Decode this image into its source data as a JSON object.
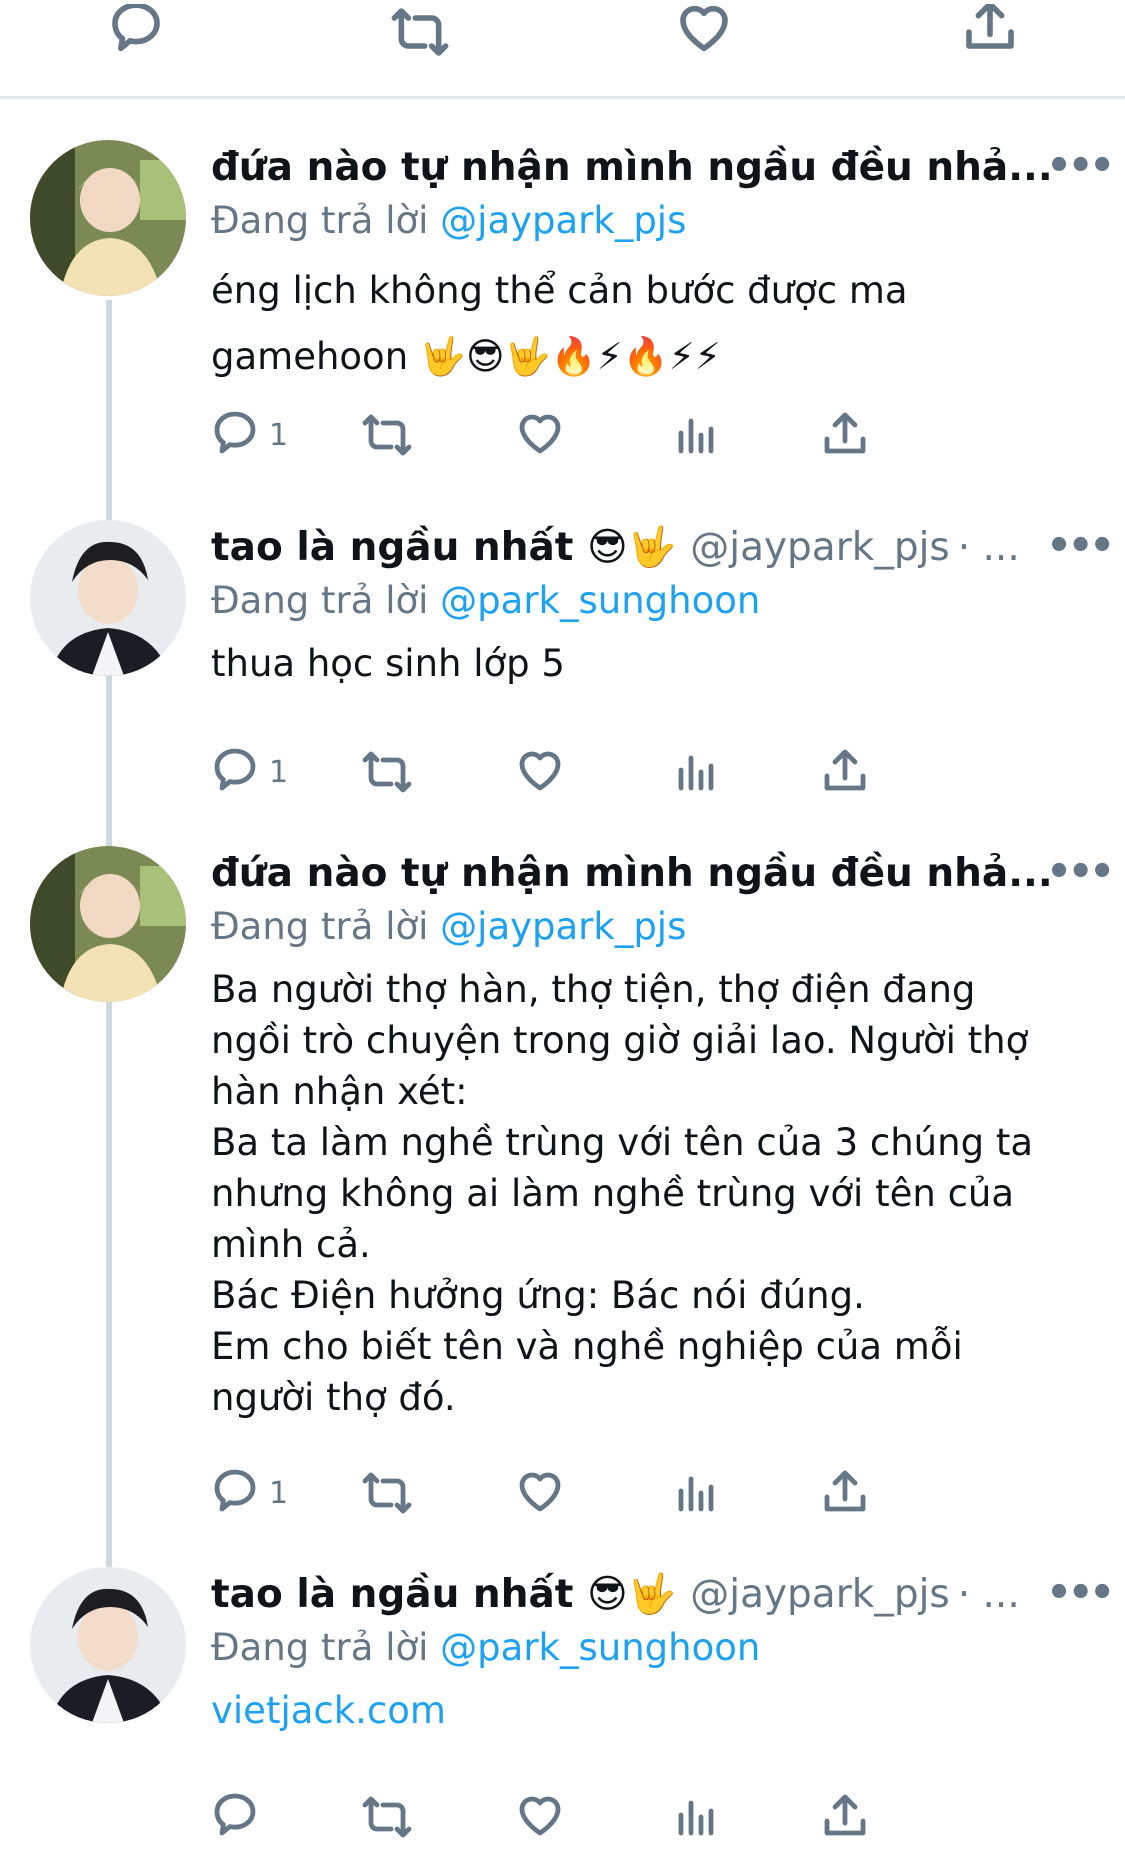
{
  "top_actions": [
    "reply-icon",
    "retweet-icon",
    "like-icon",
    "share-icon"
  ],
  "tweets": [
    {
      "name": "đứa nào tự nhận mình ngầu đều nhả...",
      "reply_prefix": "Đang trả lời",
      "reply_to": "@jaypark_pjs",
      "body": "éng lịch không thể cản bước được ma\ngamehoon 🤟😎🤟🔥⚡🔥⚡⚡",
      "reply_count": "1"
    },
    {
      "name": "tao là ngầu nhất 😎🤟",
      "handle": "@jaypark_pjs",
      "trail": "· ...",
      "reply_prefix": "Đang trả lời",
      "reply_to": "@park_sunghoon",
      "body": "thua học sinh lớp 5",
      "reply_count": "1"
    },
    {
      "name": "đứa nào tự nhận mình ngầu đều nhả...",
      "reply_prefix": "Đang trả lời",
      "reply_to": "@jaypark_pjs",
      "body": "Ba người thợ hàn, thợ tiện, thợ điện đang\nngồi trò chuyện trong giờ giải lao. Người thợ\nhàn nhận xét:\nBa ta làm nghề trùng với tên của 3 chúng ta\nnhưng không ai làm nghề trùng với tên của\nmình cả.\nBác Điện hưởng ứng: Bác nói đúng.\nEm cho biết tên và nghề nghiệp của mỗi\nngười thợ đó.",
      "reply_count": "1"
    },
    {
      "name": "tao là ngầu nhất 😎🤟",
      "handle": "@jaypark_pjs",
      "trail": "· ...",
      "reply_prefix": "Đang trả lời",
      "reply_to": "@park_sunghoon",
      "body": "vietjack.com",
      "reply_count": ""
    }
  ],
  "more_label": "•••",
  "colors": {
    "link": "#1da1f2",
    "muted": "#657786",
    "text": "#0f1419",
    "line": "#cfd9de"
  }
}
